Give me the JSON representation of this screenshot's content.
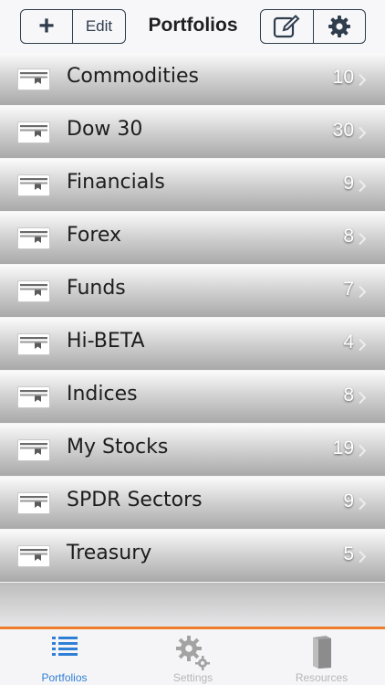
{
  "header": {
    "title": "Portfolios",
    "add_label": "+",
    "edit_label": "Edit",
    "compose_icon": "compose-icon",
    "settings_icon": "gear-icon"
  },
  "portfolios": [
    {
      "name": "Commodities",
      "count": "10"
    },
    {
      "name": "Dow 30",
      "count": "30"
    },
    {
      "name": "Financials",
      "count": "9"
    },
    {
      "name": "Forex",
      "count": "8"
    },
    {
      "name": "Funds",
      "count": "7"
    },
    {
      "name": "Hi-BETA",
      "count": "4"
    },
    {
      "name": "Indices",
      "count": "8"
    },
    {
      "name": "My Stocks",
      "count": "19"
    },
    {
      "name": "SPDR Sectors",
      "count": "9"
    },
    {
      "name": "Treasury",
      "count": "5"
    }
  ],
  "tabs": [
    {
      "label": "Portfolios",
      "icon": "list-icon",
      "active": true
    },
    {
      "label": "Settings",
      "icon": "gears-icon",
      "active": false
    },
    {
      "label": "Resources",
      "icon": "book-icon",
      "active": false
    }
  ],
  "colors": {
    "accent_orange": "#ee7d2e",
    "active_tab_blue": "#2f7fd6",
    "header_ink": "#2f3d4d"
  }
}
